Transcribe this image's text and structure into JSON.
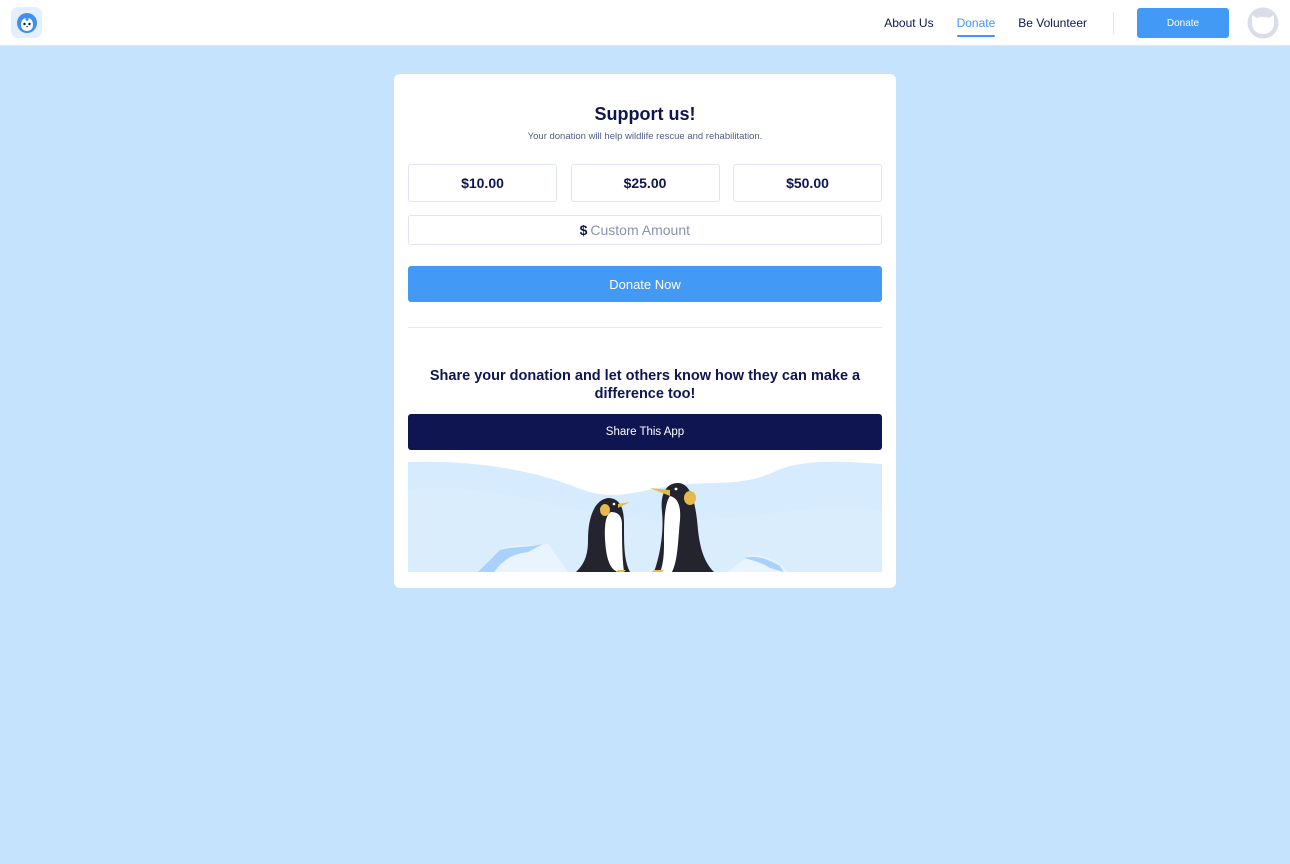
{
  "header": {
    "logo_icon": "penguin-face-icon",
    "nav": [
      {
        "label": "About Us",
        "active": false
      },
      {
        "label": "Donate",
        "active": true
      },
      {
        "label": "Be Volunteer",
        "active": false
      }
    ],
    "cta_label": "Donate",
    "avatar_icon": "user-avatar-icon"
  },
  "card": {
    "title": "Support us!",
    "subtitle": "Your donation will help wildlife rescue and rehabilitation.",
    "amounts": [
      "$10.00",
      "$25.00",
      "$50.00"
    ],
    "custom_amount": {
      "currency_symbol": "$",
      "value": "",
      "placeholder": "Custom Amount"
    },
    "donate_button": "Donate Now",
    "share_heading": "Share your donation and let others know how they can make a difference too!",
    "share_button": "Share This App",
    "illustration": "two-penguins-on-ice-illustration"
  },
  "colors": {
    "background": "#c5e3fd",
    "accent": "#4399f6",
    "navy": "#0e1550",
    "card": "#ffffff"
  }
}
